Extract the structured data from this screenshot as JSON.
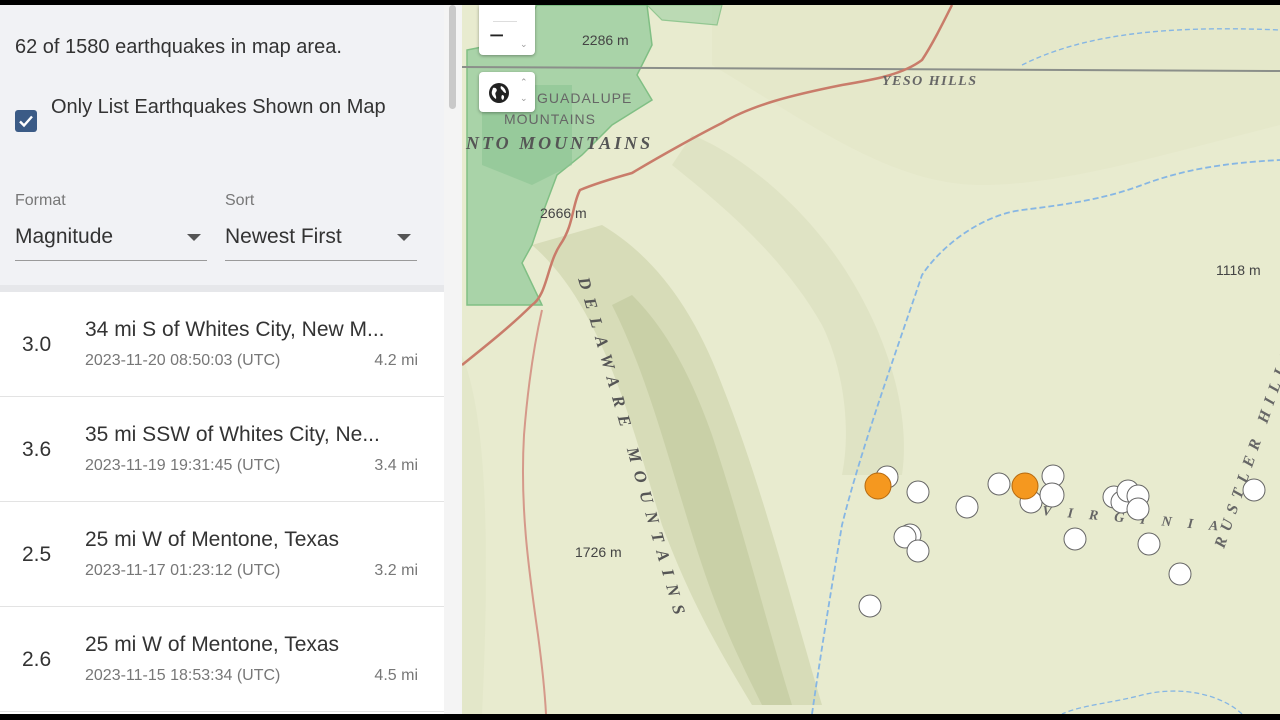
{
  "sidebar": {
    "count_text": "62 of 1580 earthquakes in map area.",
    "only_list_label": "Only List Earthquakes Shown on Map",
    "only_list_checked": true,
    "format": {
      "label": "Format",
      "value": "Magnitude"
    },
    "sort": {
      "label": "Sort",
      "value": "Newest First"
    }
  },
  "earthquakes": [
    {
      "mag": "3.0",
      "place": "34 mi S of Whites City, New M...",
      "time": "2023-11-20 08:50:03 (UTC)",
      "depth": "4.2 mi"
    },
    {
      "mag": "3.6",
      "place": "35 mi SSW of Whites City, Ne...",
      "time": "2023-11-19 19:31:45 (UTC)",
      "depth": "3.4 mi"
    },
    {
      "mag": "2.5",
      "place": "25 mi W of Mentone, Texas",
      "time": "2023-11-17 01:23:12 (UTC)",
      "depth": "3.2 mi"
    },
    {
      "mag": "2.6",
      "place": "25 mi W of Mentone, Texas",
      "time": "2023-11-15 18:53:34 (UTC)",
      "depth": "4.5 mi"
    }
  ],
  "map": {
    "zoom_out_symbol": "−",
    "basemap_icon": "globe-icon",
    "labels": {
      "elev_2286": "2286 m",
      "guadalupe": "GUADALUPE",
      "mountains_small": "MOUNTAINS",
      "nto_mountains": "NTO MOUNTAINS",
      "yeso_hills": "YESO HILLS",
      "elev_2666": "2666 m",
      "elev_1118": "1118 m",
      "delaware_mountains": "DELAWARE MOUNTAINS",
      "rustler_hills": "RUSTLER HILLS",
      "elev_1726": "1726 m",
      "virginia": "VIRGINIA"
    },
    "colors": {
      "recent_marker": "#f5981f",
      "older_marker": "#ffffff",
      "park_green": "#9fcfa2",
      "road": "#c97c6a",
      "river": "#86b6e4",
      "terrain": "#e8ebcf"
    }
  }
}
